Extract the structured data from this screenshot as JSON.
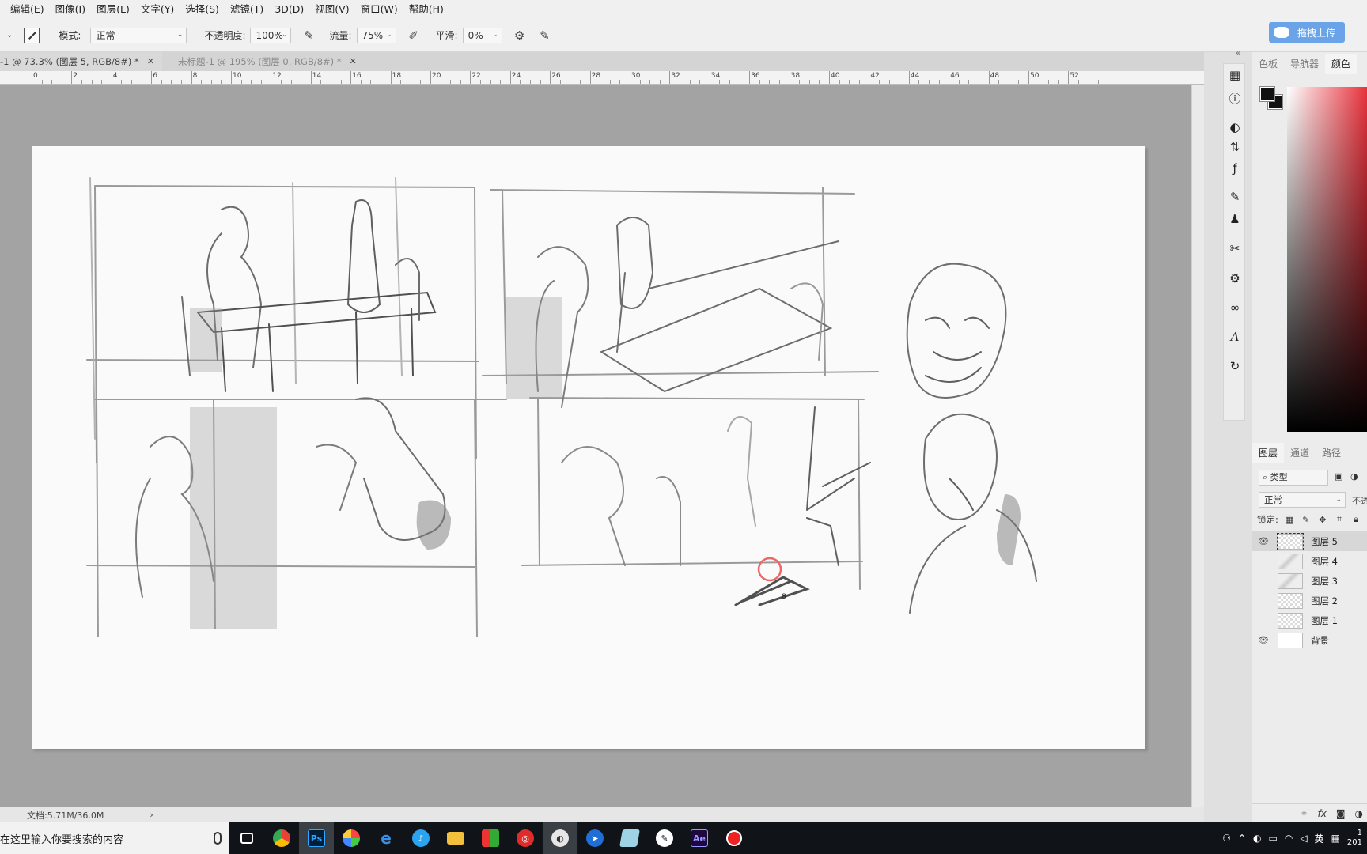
{
  "menubar": {
    "items": [
      "编辑(E)",
      "图像(I)",
      "图层(L)",
      "文字(Y)",
      "选择(S)",
      "滤镜(T)",
      "3D(D)",
      "视图(V)",
      "窗口(W)",
      "帮助(H)"
    ]
  },
  "options": {
    "mode_label": "模式:",
    "mode_value": "正常",
    "opacity_label": "不透明度:",
    "opacity_value": "100%",
    "flow_label": "流量:",
    "flow_value": "75%",
    "smoothing_label": "平滑:",
    "smoothing_value": "0%",
    "upload_label": "拖拽上传"
  },
  "tabs": [
    {
      "label": "-1 @ 73.3% (图层 5, RGB/8#) *"
    },
    {
      "label": "未标题-1 @ 195% (图层 0, RGB/8#) *"
    }
  ],
  "ruler": {
    "labels": [
      "0",
      "2",
      "4",
      "6",
      "8",
      "10",
      "12",
      "14",
      "16",
      "18",
      "20",
      "22",
      "24",
      "26",
      "28",
      "30",
      "32",
      "34",
      "36",
      "38",
      "40",
      "42",
      "44",
      "46",
      "48",
      "50",
      "52"
    ]
  },
  "status": {
    "doc_size": "文档:5.71M/36.0M"
  },
  "panels": {
    "color_tabs": [
      "色板",
      "导航器",
      "颜色"
    ],
    "layer_tabs": [
      "图层",
      "通道",
      "路径"
    ],
    "filter_label": "类型",
    "blend_mode": "正常",
    "opacity_short": "不透",
    "lock_label": "锁定:",
    "layers": [
      {
        "name": "图层 5",
        "visible": true,
        "selected": true
      },
      {
        "name": "图层 4",
        "visible": false,
        "selected": false
      },
      {
        "name": "图层 3",
        "visible": false,
        "selected": false
      },
      {
        "name": "图层 2",
        "visible": false,
        "selected": false
      },
      {
        "name": "图层 1",
        "visible": false,
        "selected": false
      },
      {
        "name": "背景",
        "visible": true,
        "selected": false
      }
    ],
    "bottom_fx": "fx"
  },
  "taskbar": {
    "search_placeholder": "在这里输入你要搜索的内容",
    "apps": [
      "task-view",
      "chrome",
      "photoshop",
      "paint",
      "edge",
      "tiktok",
      "file-explorer",
      "store",
      "netease-music",
      "eagle-app",
      "blue-arrow-app",
      "notes",
      "pen-app",
      "after-effects",
      "recorder"
    ],
    "photoshop_label": "Ps",
    "ae_label": "Ae",
    "ime": "英",
    "clock_top": "1",
    "clock_bottom": "201"
  },
  "canvas": {
    "brush_size_label": "8"
  },
  "colors": {
    "accent_blue": "#6aa3e8",
    "spectrum_red": "#e8303a",
    "ps_blue": "#31a8ff",
    "ae_purple": "#9999ff"
  }
}
